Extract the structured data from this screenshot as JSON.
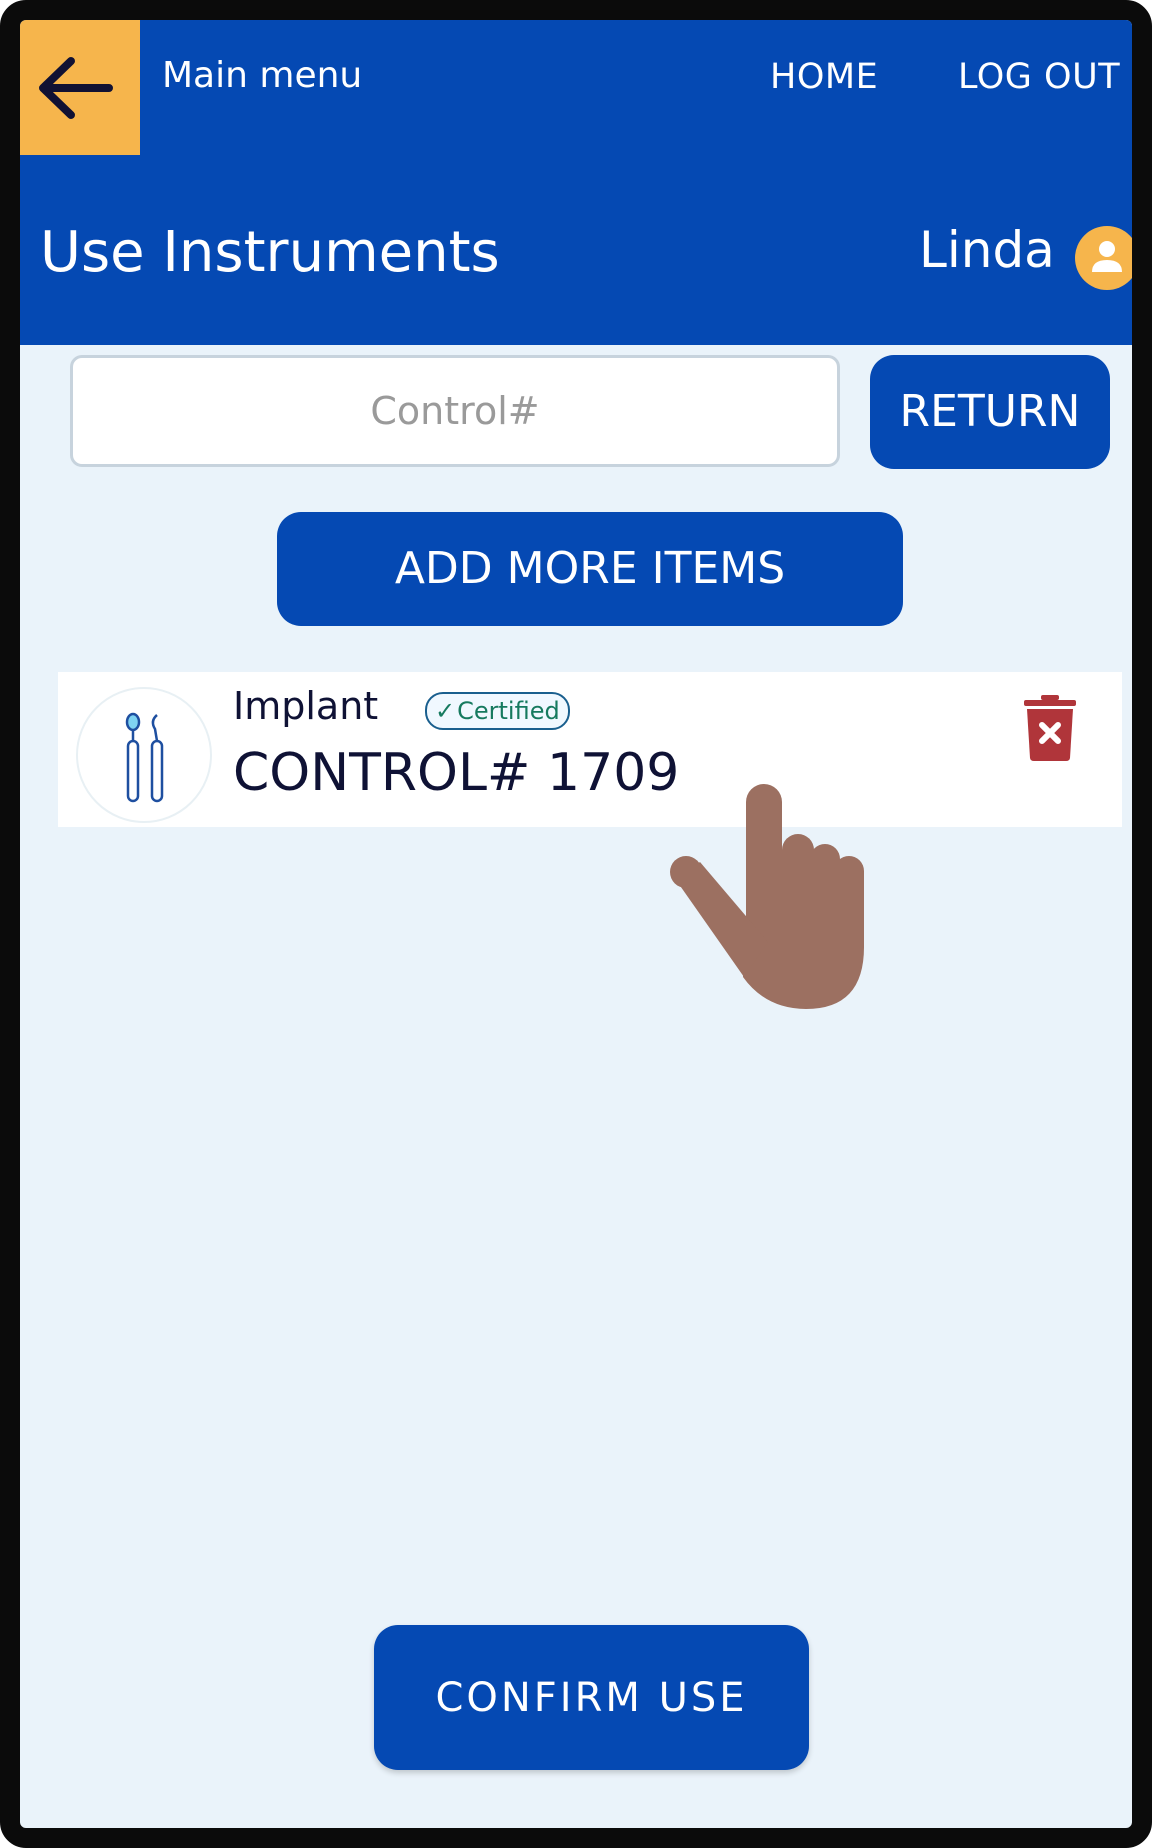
{
  "header": {
    "back_icon": "arrow-left-icon",
    "main_menu_label": "Main menu",
    "nav": {
      "home": "HOME",
      "logout": "LOG OUT"
    }
  },
  "page": {
    "title": "Use Instruments",
    "user_name": "Linda",
    "avatar_icon": "user-icon"
  },
  "search": {
    "placeholder": "Control#",
    "value": ""
  },
  "buttons": {
    "return_label": "RETURN",
    "add_more_label": "ADD MORE ITEMS",
    "confirm_label": "CONFIRM USE"
  },
  "items": [
    {
      "type": "Implant",
      "badge": "Certified",
      "badge_icon": "check-icon",
      "control": "CONTROL# 1709",
      "icon": "dental-instruments-icon",
      "delete_icon": "trash-icon"
    }
  ],
  "colors": {
    "primary": "#0549b3",
    "accent": "#f6b54c",
    "background": "#eaf3fa",
    "danger": "#b0353a",
    "certified": "#167a5f"
  }
}
